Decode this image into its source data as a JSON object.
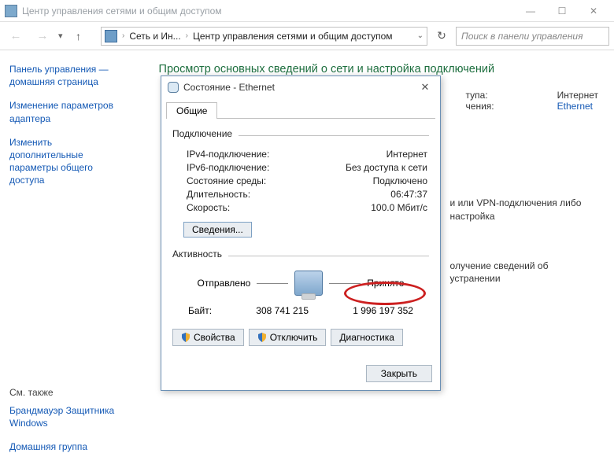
{
  "window": {
    "title": "Центр управления сетями и общим доступом",
    "min": "—",
    "max": "☐",
    "close": "✕"
  },
  "toolbar": {
    "crumb_part1": "Сеть и Ин...",
    "crumb_part2": "Центр управления сетями и общим доступом",
    "search_placeholder": "Поиск в панели управления"
  },
  "sidebar": {
    "links": [
      "Панель управления — домашняя страница",
      "Изменение параметров адаптера",
      "Изменить дополнительные параметры общего доступа"
    ],
    "see_also_label": "См. также",
    "see_also": [
      "Брандмауэр Защитника Windows",
      "Домашняя группа"
    ]
  },
  "content": {
    "heading": "Просмотр основных сведений о сети и настройка подключений",
    "access_type_label": "тупа:",
    "access_type_value": "Интернет",
    "conn_label": "чения:",
    "conn_value": "Ethernet",
    "text1_suffix": "и или VPN-подключения либо настройка",
    "text2_suffix": "олучение сведений об устранении"
  },
  "dialog": {
    "title": "Состояние - Ethernet",
    "tab": "Общие",
    "group_conn": "Подключение",
    "rows": [
      {
        "k": "IPv4-подключение:",
        "v": "Интернет"
      },
      {
        "k": "IPv6-подключение:",
        "v": "Без доступа к сети"
      },
      {
        "k": "Состояние среды:",
        "v": "Подключено"
      },
      {
        "k": "Длительность:",
        "v": "06:47:37"
      },
      {
        "k": "Скорость:",
        "v": "100.0 Мбит/с"
      }
    ],
    "details_btn": "Сведения...",
    "group_act": "Активность",
    "sent_label": "Отправлено",
    "recv_label": "Принято",
    "bytes_label": "Байт:",
    "bytes_sent": "308 741 215",
    "bytes_recv": "1 996 197 352",
    "btn_props": "Свойства",
    "btn_disable": "Отключить",
    "btn_diag": "Диагностика",
    "btn_close": "Закрыть"
  }
}
